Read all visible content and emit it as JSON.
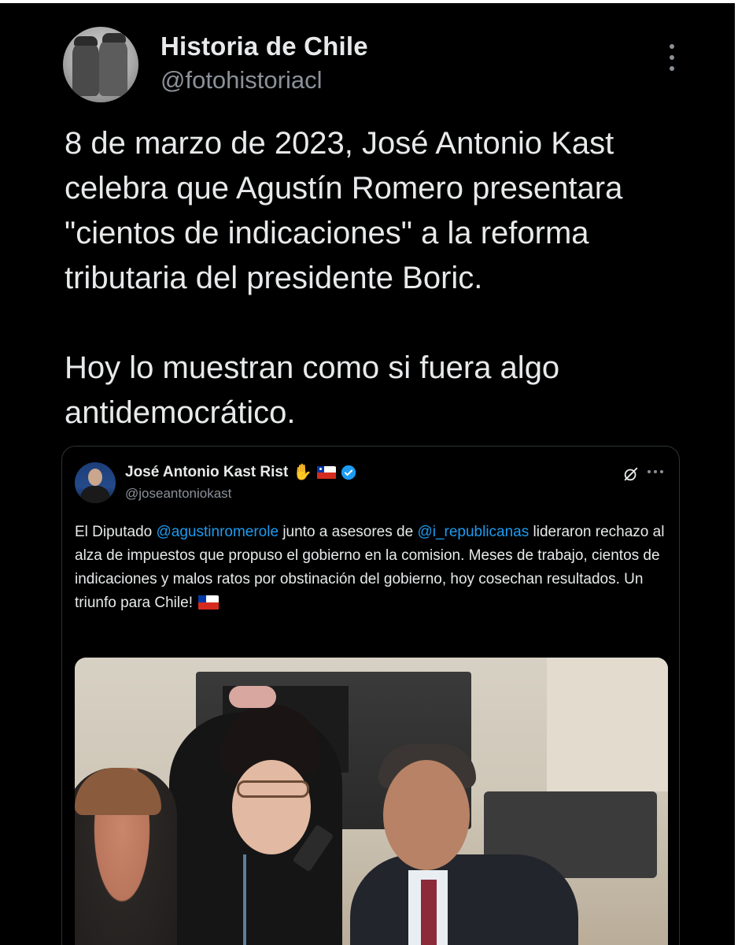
{
  "outer_tweet": {
    "author_name": "Historia de Chile",
    "author_handle": "@fotohistoriacl",
    "text": "8 de marzo de 2023, José Antonio Kast celebra que Agustín Romero presentara \"cientos de indicaciones\" a la reforma tributaria del presidente Boric.\n\nHoy lo muestran como si fuera algo antidemocrático.",
    "icons": [
      "avatar",
      "more-vertical-icon"
    ]
  },
  "quoted_tweet": {
    "author_name": "José Antonio Kast Rist",
    "author_handle": "@joseantoniokast",
    "text_segments": [
      {
        "text": "El Diputado ",
        "type": "plain"
      },
      {
        "text": "@agustinromerole",
        "type": "mention"
      },
      {
        "text": " junto a asesores de ",
        "type": "plain"
      },
      {
        "text": "@i_republicanas",
        "type": "mention"
      },
      {
        "text": " lideraron rechazo al alza de impuestos que propuso el gobierno en la comision. Meses de trabajo, cientos de indicaciones y malos ratos por obstinación del gobierno, hoy cosechan resultados. Un triunfo para Chile! ",
        "type": "plain"
      }
    ],
    "icons": [
      "raised-hand-icon",
      "chile-flag-icon",
      "verified-badge-icon",
      "grok-icon",
      "more-horizontal-icon"
    ],
    "photo_description_icon": "photo"
  },
  "colors": {
    "background": "#000000",
    "text_primary": "#e7e9ea",
    "text_secondary": "#8b9199",
    "link": "#1d9bf0",
    "verified": "#1d9bf0",
    "card_border": "#2f3336"
  }
}
